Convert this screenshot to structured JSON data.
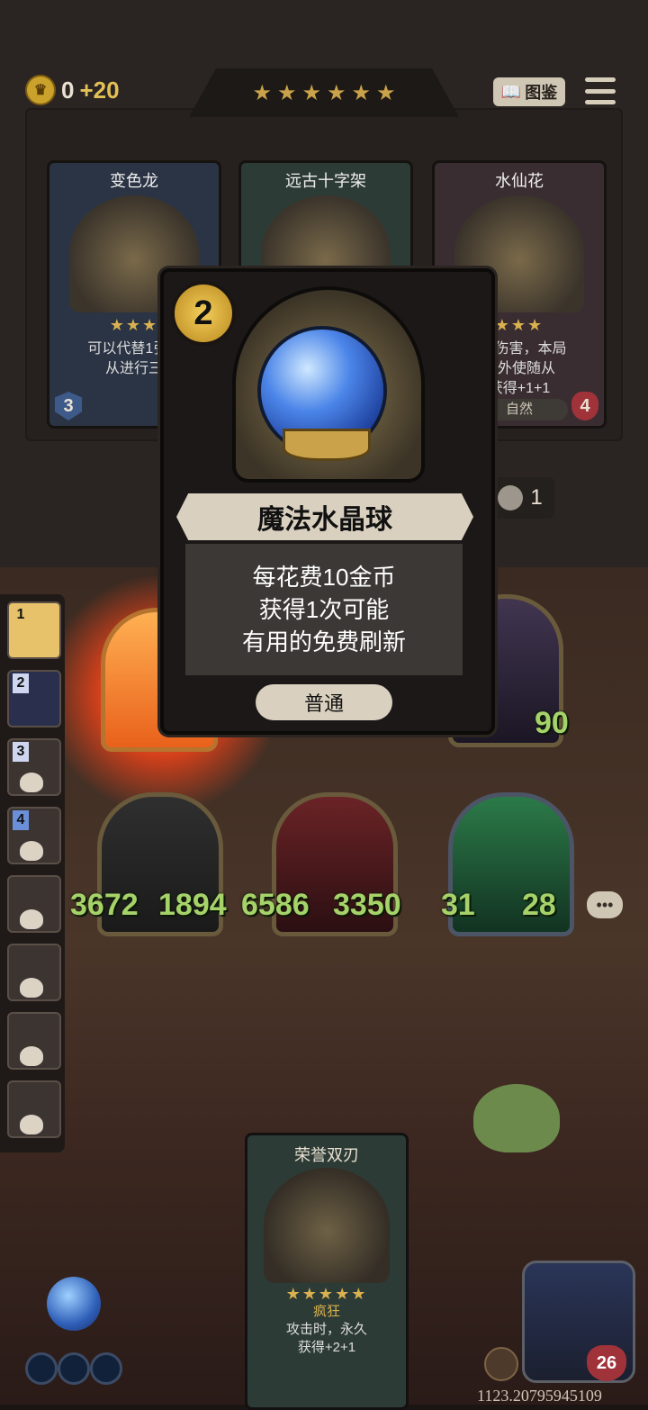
{
  "header": {
    "gold_value": "0",
    "gold_income": "+20",
    "star_count": 6,
    "gallery_label": "图鉴"
  },
  "shop": {
    "cards": [
      {
        "name": "变色龙",
        "desc": "可以代替1张1-\n从进行三",
        "cost": "3"
      },
      {
        "name": "远古十字架",
        "desc": "",
        "cost": ""
      },
      {
        "name": "水仙花",
        "desc": "2次伤害，本局\n额外使随从\n获得+1+1",
        "tribe": "自然",
        "cost": "4"
      }
    ],
    "reroll_count": "1"
  },
  "popup": {
    "tier": "2",
    "name": "魔法水晶球",
    "description_lines": [
      "每花费10金币",
      "获得1次可能",
      "有用的免费刷新"
    ],
    "rarity": "普通"
  },
  "board": {
    "rail_slots": [
      "1",
      "2",
      "3",
      "4",
      "",
      "",
      "",
      ""
    ],
    "units": [
      {
        "attack": "3672",
        "health": "1894"
      },
      {
        "attack": "6586",
        "health": "3350"
      },
      {
        "attack": "31",
        "health": "28"
      }
    ],
    "top_unit_health": "90"
  },
  "hand_card": {
    "name": "荣誉双刃",
    "tag": "疯狂",
    "desc": "攻击时，永久\n获得+2+1"
  },
  "player": {
    "health": "26"
  },
  "coordinates": "1123.20795945109"
}
